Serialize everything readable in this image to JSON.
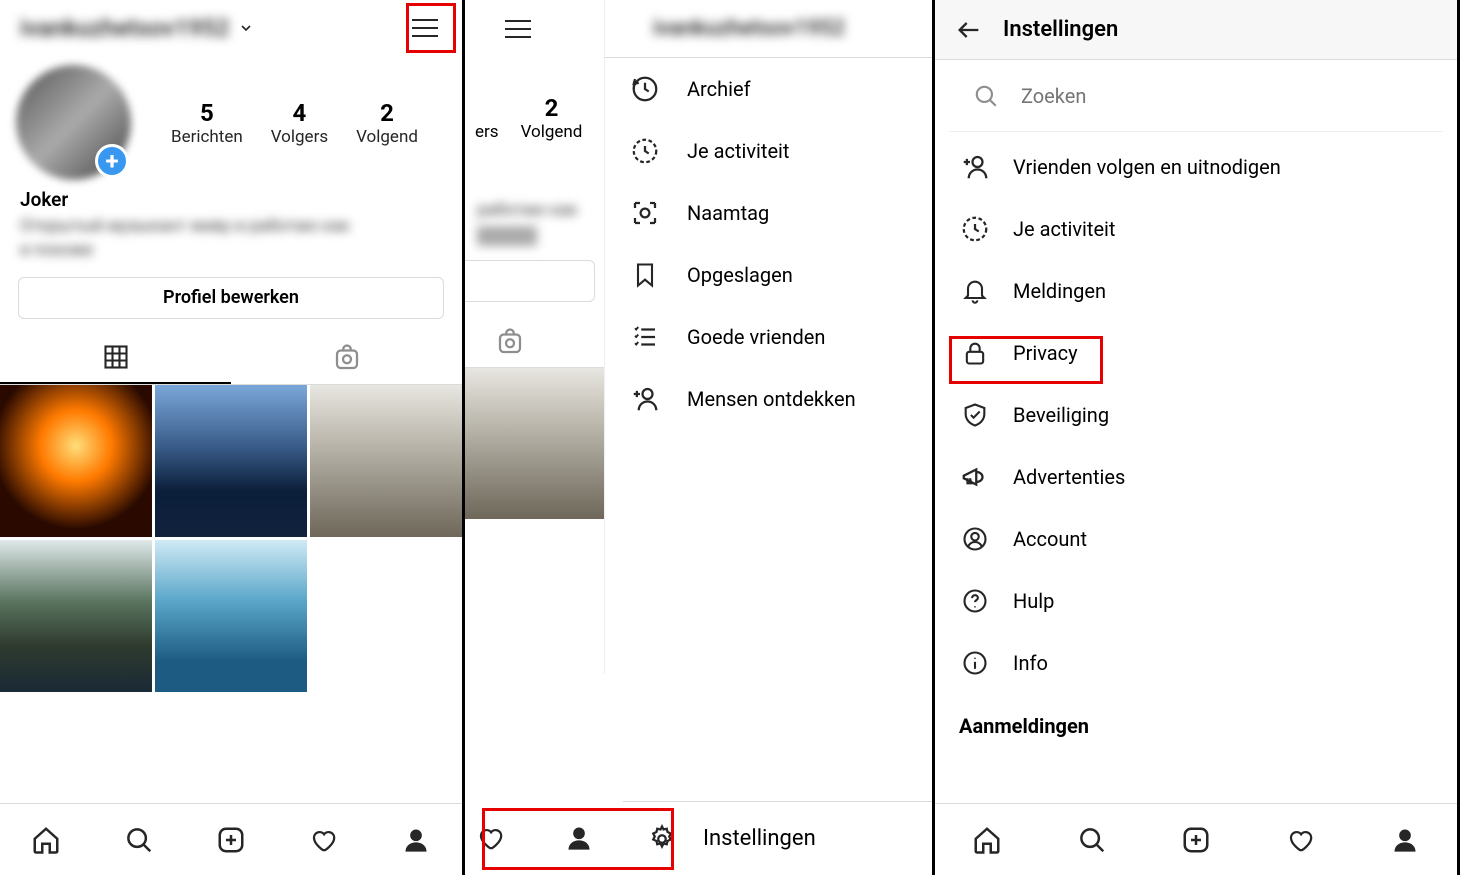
{
  "panel1": {
    "username_masked": "ivankuzhetsov1952",
    "stats": [
      {
        "n": "5",
        "label": "Berichten"
      },
      {
        "n": "4",
        "label": "Volgers"
      },
      {
        "n": "2",
        "label": "Volgend"
      }
    ],
    "display_name": "Joker",
    "bio_masked": "Открытый музыкант живу и работаю как",
    "bio_line2_masked": "и похоже",
    "edit_profile": "Profiel bewerken"
  },
  "panel2": {
    "username_masked": "ivankuzhetsov1952",
    "partial_stats": [
      {
        "n": "",
        "label": "ers"
      },
      {
        "n": "2",
        "label": "Volgend"
      }
    ],
    "bio_partial_masked": "работаю как",
    "menu": [
      {
        "icon": "archive",
        "label": "Archief"
      },
      {
        "icon": "activity",
        "label": "Je activiteit"
      },
      {
        "icon": "nametag",
        "label": "Naamtag"
      },
      {
        "icon": "saved",
        "label": "Opgeslagen"
      },
      {
        "icon": "closefriends",
        "label": "Goede vrienden"
      },
      {
        "icon": "discover",
        "label": "Mensen ontdekken"
      }
    ],
    "settings_label": "Instellingen"
  },
  "panel3": {
    "title": "Instellingen",
    "search_placeholder": "Zoeken",
    "items": [
      {
        "icon": "adduser",
        "label": "Vrienden volgen en uitnodigen"
      },
      {
        "icon": "activity",
        "label": "Je activiteit"
      },
      {
        "icon": "bell",
        "label": "Meldingen"
      },
      {
        "icon": "lock",
        "label": "Privacy"
      },
      {
        "icon": "shield",
        "label": "Beveiliging"
      },
      {
        "icon": "megaphone",
        "label": "Advertenties"
      },
      {
        "icon": "account",
        "label": "Account"
      },
      {
        "icon": "help",
        "label": "Hulp"
      },
      {
        "icon": "info",
        "label": "Info"
      }
    ],
    "section_header": "Aanmeldingen"
  }
}
